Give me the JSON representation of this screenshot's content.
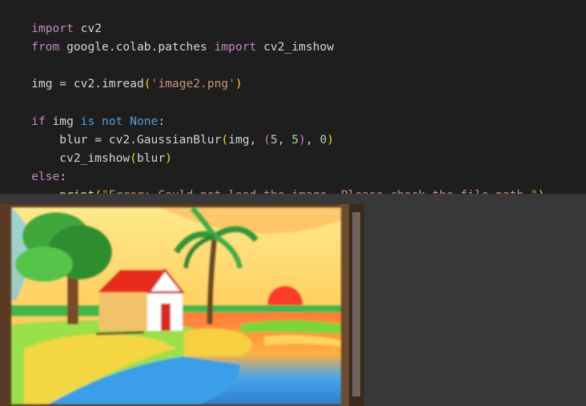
{
  "code": {
    "line1": {
      "kw": "import",
      "rest": " cv2"
    },
    "line2": {
      "kw1": "from",
      "mod": " google.colab.patches ",
      "kw2": "import",
      "rest": " cv2_imshow"
    },
    "line4": {
      "pre": "img = cv2.imread",
      "open": "(",
      "str": "'image2.png'",
      "close": ")"
    },
    "line6": {
      "kw1": "if",
      "var": " img ",
      "kw2": "is not",
      "sp": " ",
      "none": "None",
      "colon": ":"
    },
    "line7": {
      "pre": "    blur = cv2.GaussianBlur",
      "open": "(",
      "arg": "img, ",
      "open2": "(",
      "n1": "5",
      "comma": ", ",
      "n2": "5",
      "close2": ")",
      "comma2": ", ",
      "n3": "0",
      "close": ")"
    },
    "line8": {
      "pre": "    cv2_imshow",
      "open": "(",
      "arg": "blur",
      "close": ")"
    },
    "line9": {
      "kw": "else",
      "colon": ":"
    },
    "line10": {
      "fn": "    print",
      "open": "(",
      "str": "\"Error: Could not load the image. Please check the file path.\"",
      "close": ")"
    }
  },
  "output": {
    "image_alt": "Blurred crayon drawing of a red-roofed house, trees, palm tree, setting sun and river"
  }
}
